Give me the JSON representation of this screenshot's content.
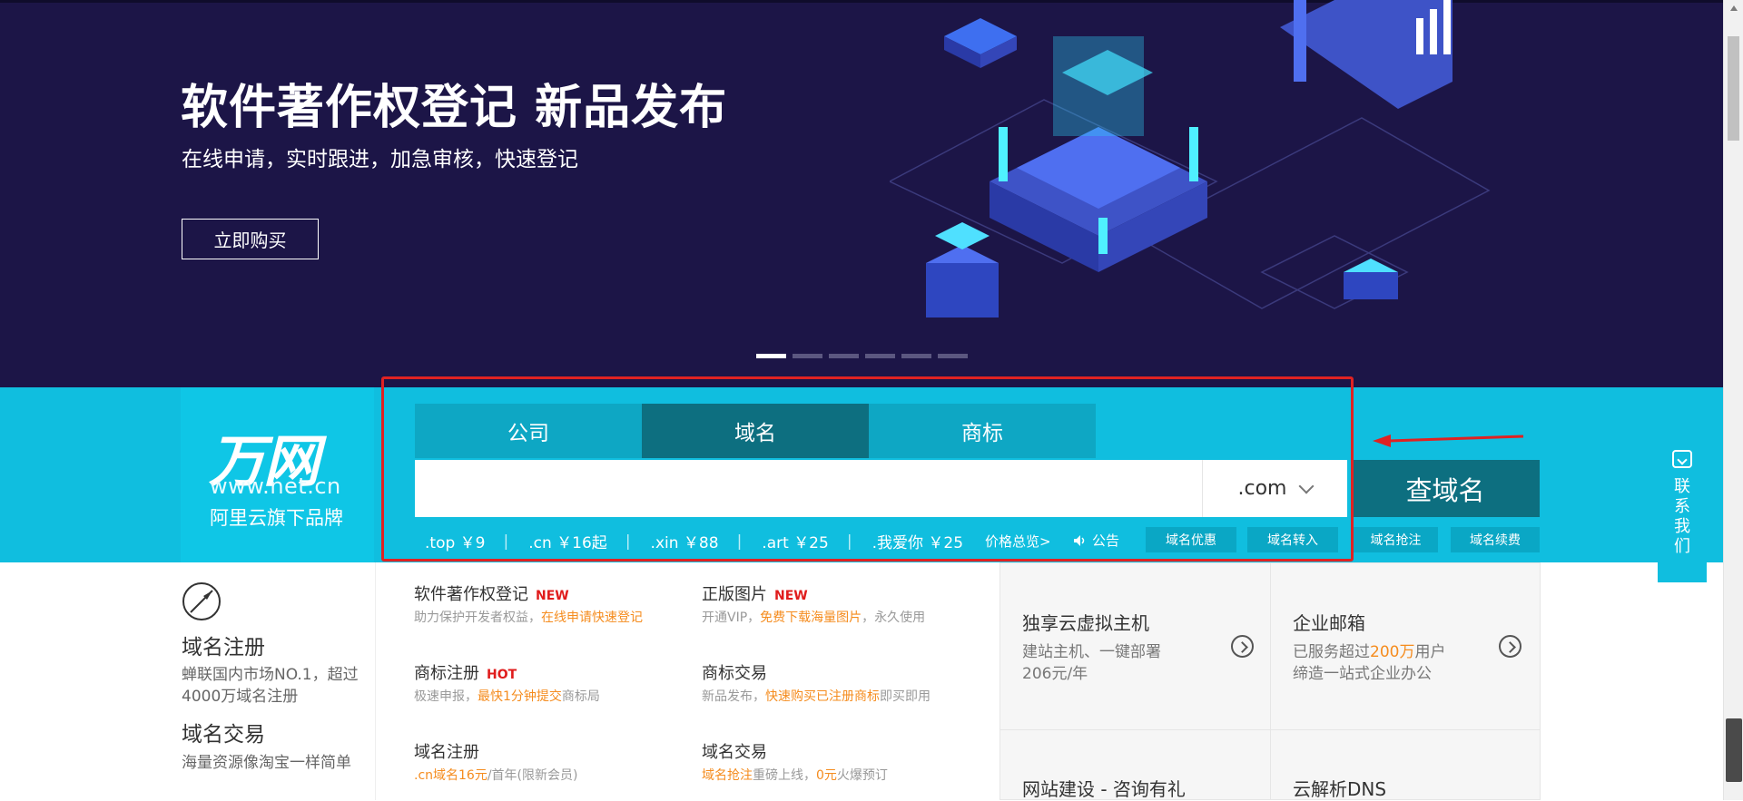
{
  "banner": {
    "title": "软件著作权登记 新品发布",
    "subtitle": "在线申请，实时跟进，加急审核，快速登记",
    "button": "立即购买",
    "slides": 6,
    "active_slide": 1
  },
  "logo": {
    "main": "万网",
    "url": "www.net.cn",
    "sub": "阿里云旗下品牌"
  },
  "search": {
    "tabs": [
      "公司",
      "域名",
      "商标"
    ],
    "active_tab": 1,
    "input_value": "",
    "tld": ".com",
    "button": "查域名",
    "prices": [
      {
        "tld": ".top",
        "price": "￥9"
      },
      {
        "tld": ".cn",
        "price": "￥16起"
      },
      {
        "tld": ".xin",
        "price": "￥88"
      },
      {
        "tld": ".art",
        "price": "￥25"
      },
      {
        "tld": ".我爱你",
        "price": "￥25"
      }
    ],
    "price_all": "价格总览>",
    "notice": "公告",
    "links": [
      "域名优惠",
      "域名转入",
      "域名抢注",
      "域名续费"
    ]
  },
  "left": {
    "domain_reg_title": "域名注册",
    "domain_reg_desc": "蝉联国内市场NO.1，超过4000万域名注册",
    "domain_trade_title": "域名交易",
    "domain_trade_desc": "海量资源像淘宝一样简单"
  },
  "services": {
    "s1": {
      "title": "软件著作权登记",
      "badge": "NEW",
      "desc_a": "助力保护开发者权益，",
      "desc_hl": "在线申请快速登记",
      "desc_b": ""
    },
    "s2": {
      "title": "正版图片",
      "badge": "NEW",
      "desc_a": "开通VIP，",
      "desc_hl": "免费下载海量图片",
      "desc_b": "，永久使用"
    },
    "s3": {
      "title": "商标注册",
      "badge": "HOT",
      "desc_a": "极速申报，",
      "desc_hl": "最快1分钟提交",
      "desc_b": "商标局"
    },
    "s4": {
      "title": "商标交易",
      "badge": "",
      "desc_a": "新品发布，",
      "desc_hl": "快速购买已注册商标",
      "desc_b": "即买即用"
    },
    "s5": {
      "title": "域名注册",
      "badge": "",
      "desc_a": "",
      "desc_hl": ".cn域名16元",
      "desc_b": "/首年(限新会员)"
    },
    "s6": {
      "title": "域名交易",
      "badge": "",
      "desc_a": "",
      "desc_hl": "域名抢注",
      "desc_b": "重磅上线，"
    }
  },
  "s6_extra": {
    "hl": "0元",
    "tail": "火爆预订"
  },
  "cards": {
    "c1": {
      "title": "独享云虚拟主机",
      "line1": "建站主机、一键部署",
      "line2": "206元/年"
    },
    "c2": {
      "title": "企业邮箱",
      "line1a": "已服务超过",
      "line1hl": "200万",
      "line1b": "用户",
      "line2": "缔造一站式企业办公"
    },
    "c3": {
      "title": "网站建设 - 咨询有礼"
    },
    "c4": {
      "title": "云解析DNS"
    }
  },
  "float_contact": {
    "label": "联系我们"
  },
  "colors": {
    "banner_bg": "#1c1547",
    "band_bg": "#10bedf",
    "tab_active": "#0d6f80",
    "highlight": "#f58c1e",
    "badge_red": "#e01c1c"
  }
}
